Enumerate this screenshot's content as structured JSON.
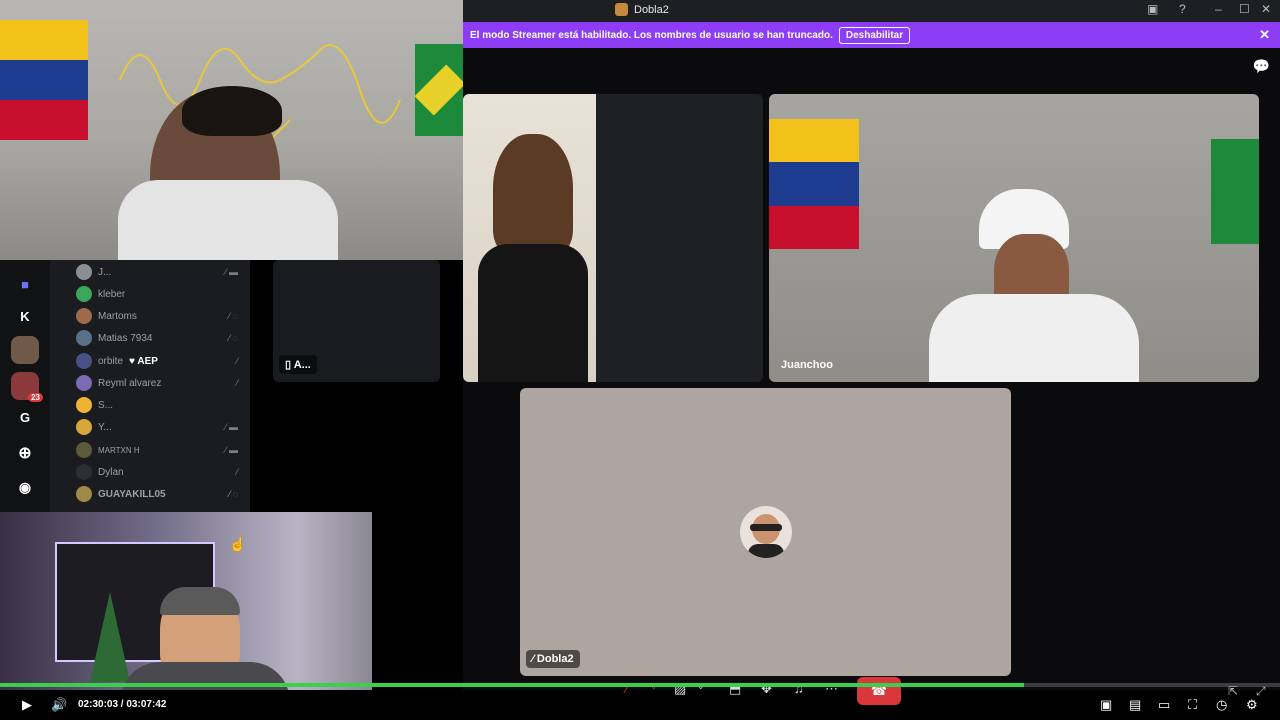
{
  "window": {
    "title": "Dobla2"
  },
  "banner": {
    "message": "El modo Streamer está habilitado. Los nombres de usuario se han truncado.",
    "button": "Deshabilitar",
    "close": "✕"
  },
  "guilds": [
    "K",
    "G"
  ],
  "guild_badge": "23",
  "members": [
    {
      "name": "J...",
      "color": "#8b8e94"
    },
    {
      "name": "kleber",
      "color": "#3ba55c"
    },
    {
      "name": "Martoms",
      "color": "#a06a4a"
    },
    {
      "name": "Matias 7934",
      "color": "#5a6f8a"
    },
    {
      "name": "orbite",
      "extra": "♥ AEP",
      "color": "#4a4f86"
    },
    {
      "name": "Reyml alvarez",
      "color": "#7a6bb2"
    },
    {
      "name": "S...",
      "color": "#f0b232"
    },
    {
      "name": "Y...",
      "color": "#d9a63a"
    },
    {
      "name": "MARTXN H",
      "color": "#5c5a3a"
    },
    {
      "name": "Dylan",
      "color": "#2e2f34"
    },
    {
      "name": "GUAYAKILL05",
      "color": "#a08a4a"
    }
  ],
  "tiles": {
    "a_label": "A...",
    "juanchoo_label": "Juanchoo",
    "dobla2_label": "Dobla2"
  },
  "player": {
    "time": "02:30:03 / 03:07:42",
    "progress_percent": 80
  },
  "colors": {
    "banner": "#8d3df5",
    "progress": "#3ccf4e",
    "hangup": "#da373c"
  }
}
